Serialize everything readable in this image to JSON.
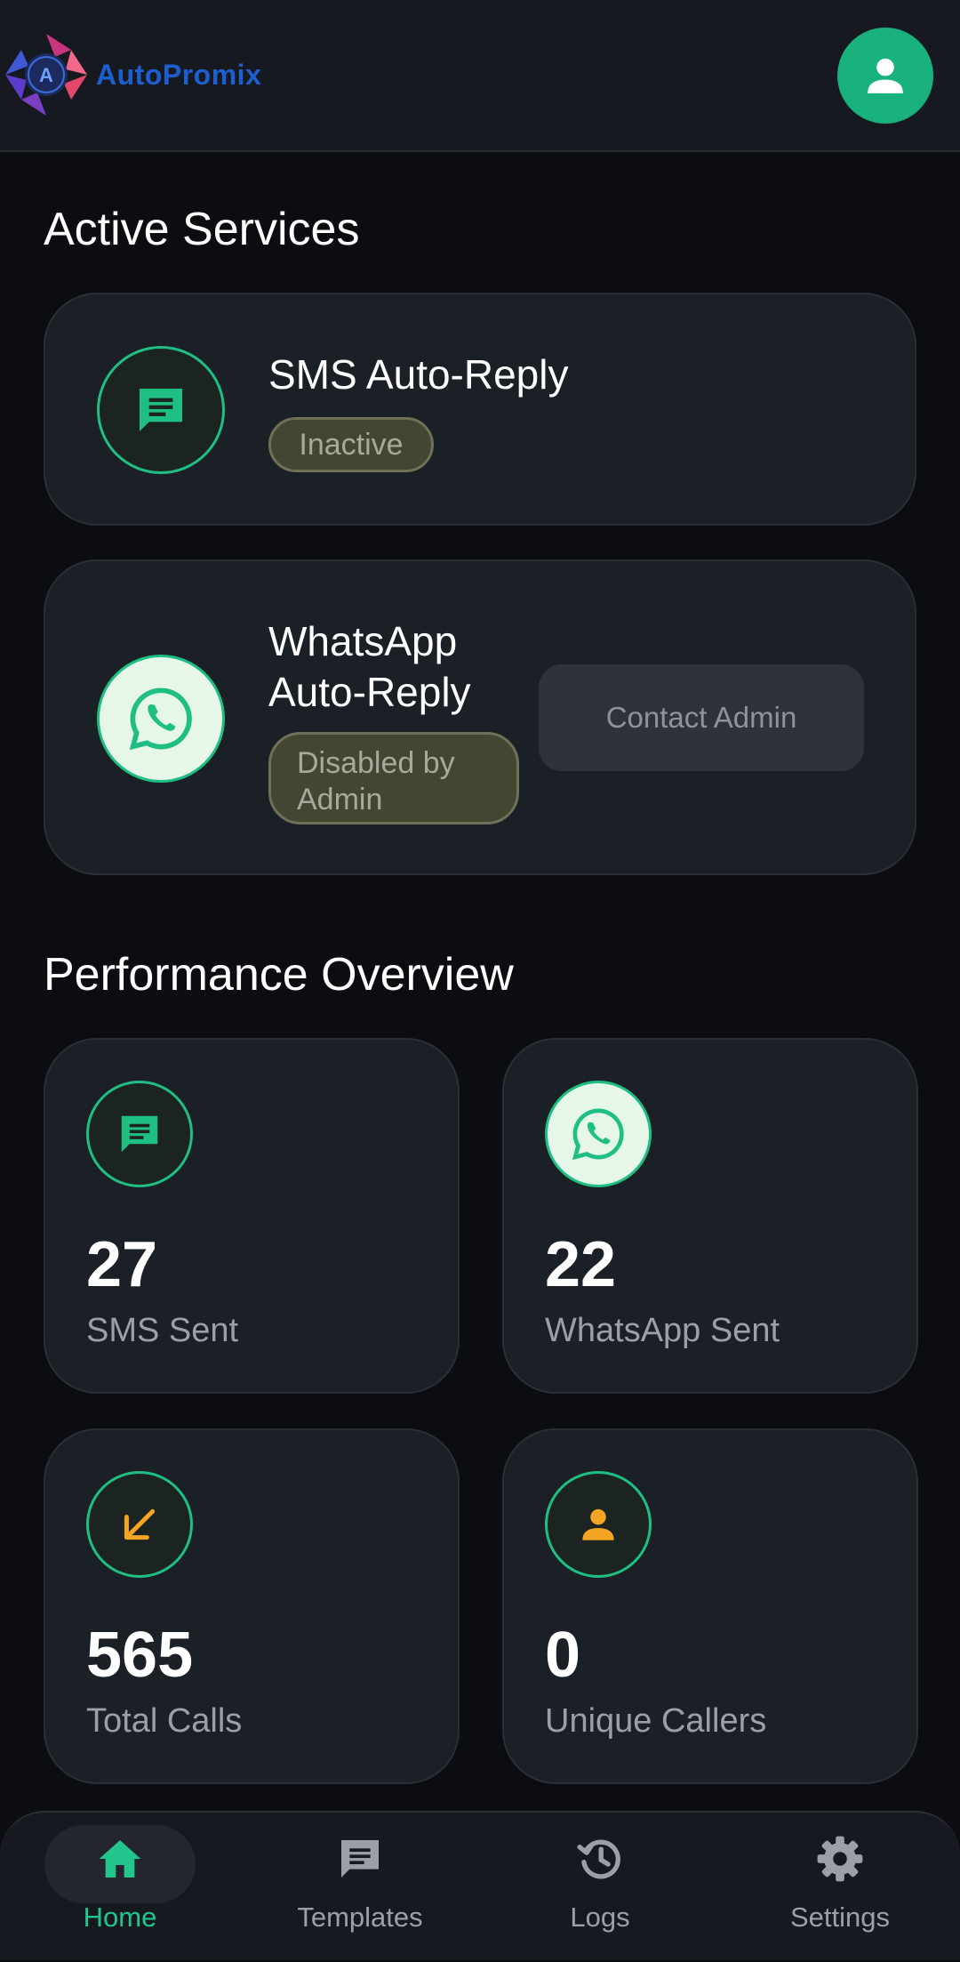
{
  "header": {
    "app_name": "AutoPromix",
    "logo_letter": "A"
  },
  "sections": {
    "active_services": "Active Services",
    "performance": "Performance Overview"
  },
  "services": {
    "sms": {
      "title": "SMS Auto-Reply",
      "status": "Inactive",
      "icon": "sms-icon"
    },
    "whatsapp": {
      "title_line1": "WhatsApp",
      "title_line2": "Auto-Reply",
      "status_line1": "Disabled by",
      "status_line2": "Admin",
      "action": "Contact Admin",
      "icon": "whatsapp-icon"
    }
  },
  "stats": [
    {
      "value": "27",
      "label": "SMS Sent",
      "icon": "sms-icon"
    },
    {
      "value": "22",
      "label": "WhatsApp Sent",
      "icon": "whatsapp-icon"
    },
    {
      "value": "565",
      "label": "Total Calls",
      "icon": "incoming-call-icon"
    },
    {
      "value": "0",
      "label": "Unique Callers",
      "icon": "person-icon"
    }
  ],
  "nav": [
    {
      "label": "Home",
      "active": true
    },
    {
      "label": "Templates",
      "active": false
    },
    {
      "label": "Logs",
      "active": false
    },
    {
      "label": "Settings",
      "active": false
    }
  ],
  "colors": {
    "accent": "#19b27e",
    "background": "#0b0d11",
    "card": "#1b1f26",
    "warning": "#f5a524",
    "logo_text": "#1e5fd0"
  }
}
